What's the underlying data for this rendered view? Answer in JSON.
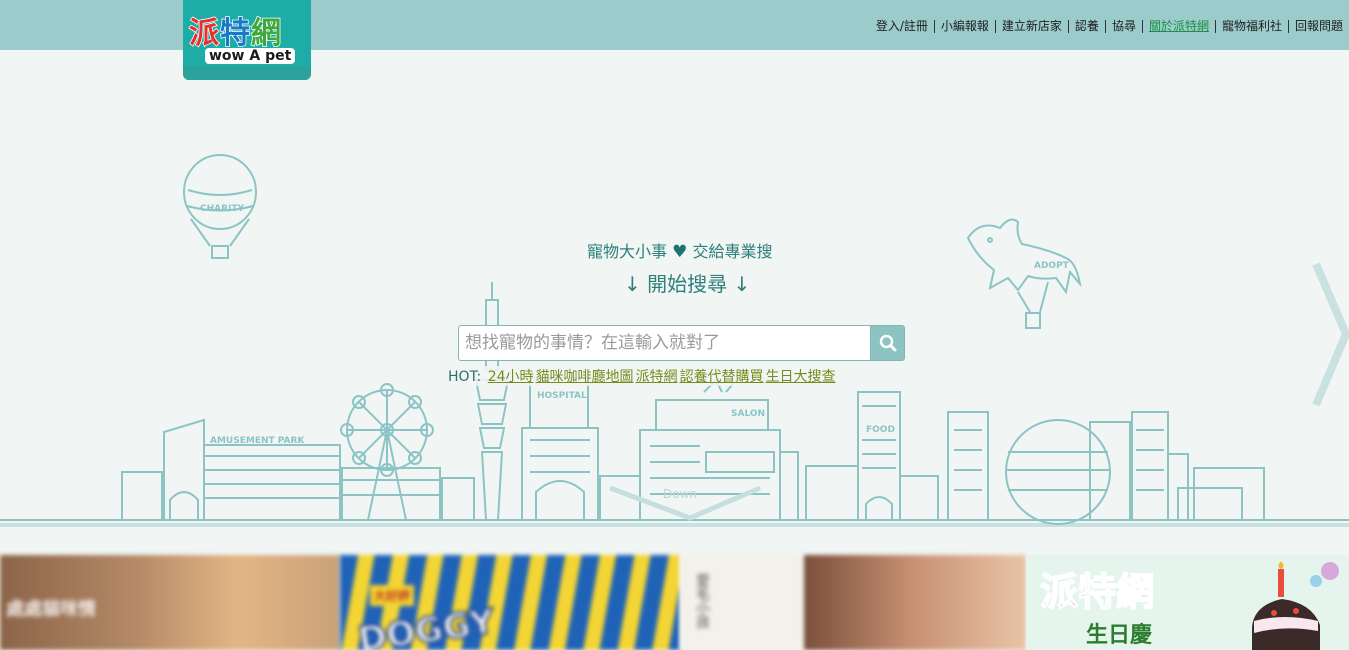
{
  "header": {
    "logo_cn_chars": [
      "派",
      "特",
      "網"
    ],
    "logo_cn_colors": [
      "#e4312f",
      "#1b78c8",
      "#3da83d"
    ],
    "logo_en": "wow A pet",
    "nav": [
      {
        "label": "登入/註冊",
        "active": false
      },
      {
        "label": "小編報報",
        "active": false
      },
      {
        "label": "建立新店家",
        "active": false
      },
      {
        "label": "認養",
        "active": false
      },
      {
        "label": "協尋",
        "active": false
      },
      {
        "label": "關於派特網",
        "active": true
      },
      {
        "label": "寵物福利社",
        "active": false
      },
      {
        "label": "回報問題",
        "active": false
      }
    ]
  },
  "hero": {
    "slogan_left": "寵物大小事",
    "slogan_right": "交給專業搜",
    "start_label": "↓ 開始搜尋 ↓",
    "search_placeholder": "想找寵物的事情？在這輸入就對了",
    "hot_label": "HOT:",
    "hot_links": [
      "24小時",
      "貓咪咖啡廳地圖",
      "派特網",
      "認養代替購買",
      "生日大搜查"
    ],
    "balloon_label": "CHARITY",
    "dog_label": "ADOPT",
    "building_labels": {
      "park": "AMUSEMENT PARK",
      "hospital": "HOSPITAL",
      "salon": "SALON",
      "food": "FOOD"
    },
    "down_label": "Down"
  },
  "banners": {
    "b1_text": "處處貓咪情",
    "b2_text": "DOGGY",
    "b2_tag": "大好評",
    "b3_text": "愛毛小孩",
    "b5_title": "派特網",
    "b5_sub": "生日慶"
  },
  "colors": {
    "topbar": "#9bcccb",
    "logo_bg": "#1eaca6",
    "line_art": "#8cc4c6",
    "text_teal": "#2d7f7b",
    "hot_link": "#7a8a1d"
  }
}
